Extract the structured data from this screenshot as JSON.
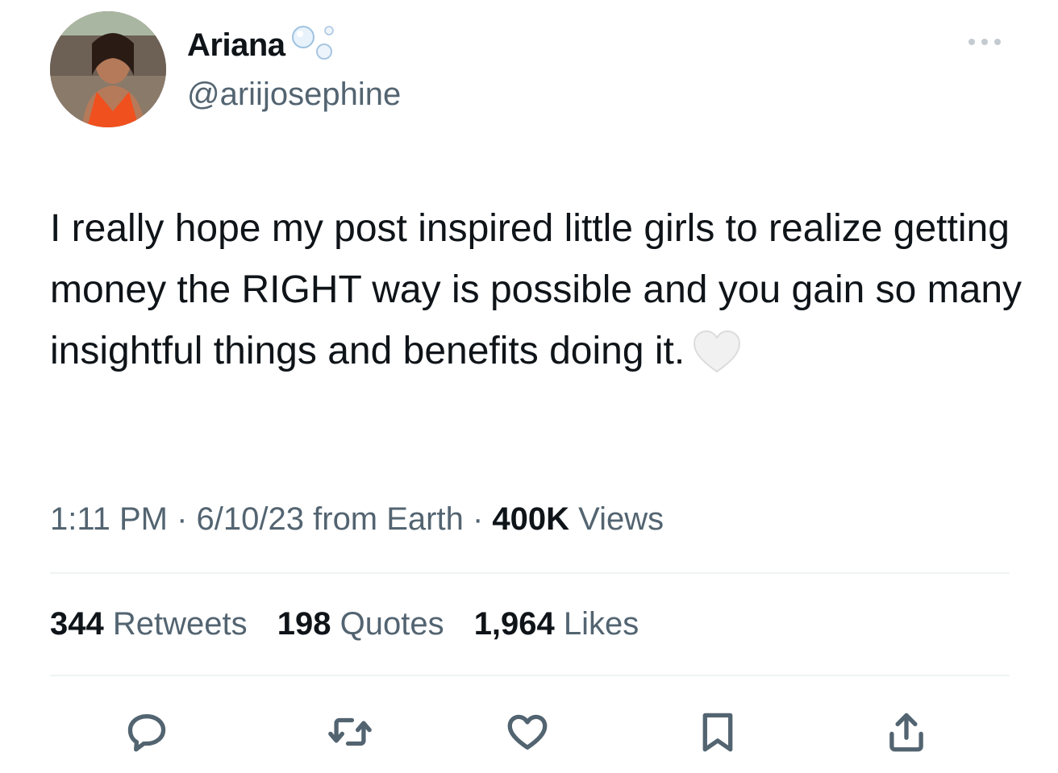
{
  "author": {
    "display_name": "Ariana",
    "handle": "@ariijosephine",
    "avatar": "profile-photo"
  },
  "tweet": {
    "text": "I really hope my post inspired little girls to realize getting money the RIGHT way is possible and you gain so many insightful things and benefits doing it.",
    "emoji": "white-heart"
  },
  "meta": {
    "time": "1:11 PM",
    "sep1": " · ",
    "date": "6/10/23",
    "source": " from Earth",
    "sep2": " · ",
    "views_count": "400K",
    "views_label": " Views"
  },
  "stats": {
    "retweets_count": "344",
    "retweets_label": " Retweets",
    "quotes_count": "198",
    "quotes_label": " Quotes",
    "likes_count": "1,964",
    "likes_label": " Likes"
  },
  "actions": [
    "reply-icon",
    "retweet-icon",
    "like-icon",
    "bookmark-icon",
    "share-icon"
  ],
  "colors": {
    "text": "#0f1419",
    "secondary": "#536471",
    "divider": "#eff3f4"
  }
}
